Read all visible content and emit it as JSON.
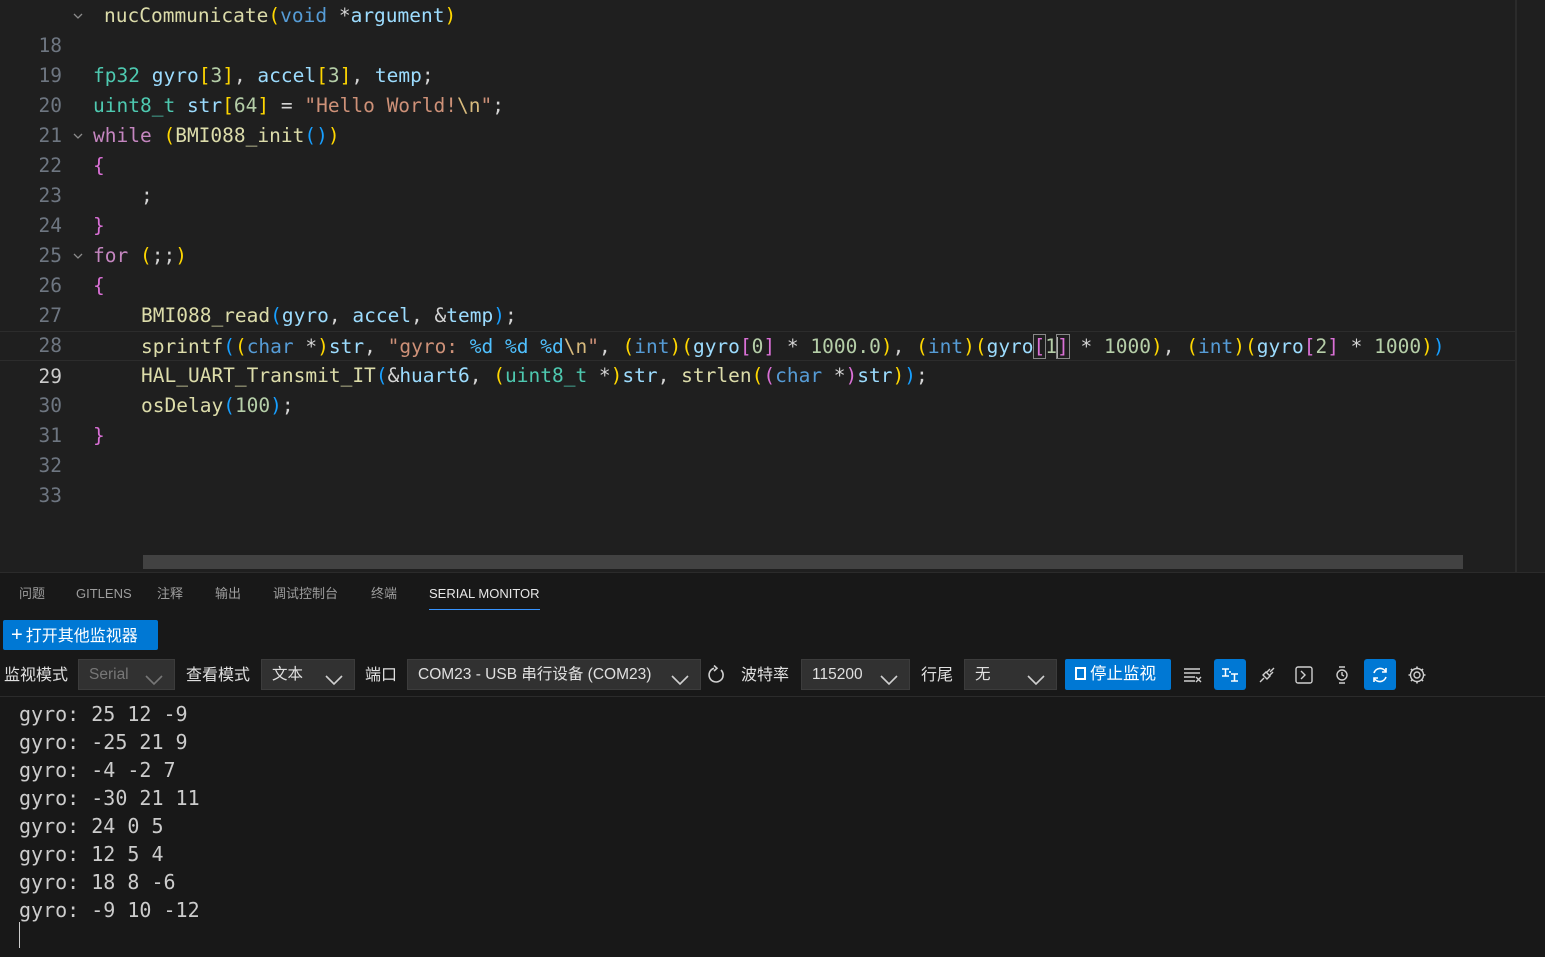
{
  "editor": {
    "lines": [
      {
        "n": "18"
      },
      {
        "n": "19"
      },
      {
        "n": "20"
      },
      {
        "n": "21"
      },
      {
        "n": "22"
      },
      {
        "n": "23"
      },
      {
        "n": "24"
      },
      {
        "n": "25"
      },
      {
        "n": "26"
      },
      {
        "n": "27"
      },
      {
        "n": "28"
      },
      {
        "n": "29"
      },
      {
        "n": "30"
      },
      {
        "n": "31"
      },
      {
        "n": "32"
      },
      {
        "n": "33"
      }
    ],
    "current_line": "29",
    "tokens": {
      "l18": [
        "nucCommunicate",
        "(",
        "void",
        " *",
        "argument",
        ")"
      ],
      "l20": [
        "fp32",
        " ",
        "gyro",
        "[",
        "3",
        "]",
        ", ",
        "accel",
        "[",
        "3",
        "]",
        ", ",
        "temp",
        ";"
      ],
      "l21": [
        "uint8_t",
        " ",
        "str",
        "[",
        "64",
        "]",
        " = ",
        "\"Hello World!",
        "\\n",
        "\"",
        ";"
      ],
      "l22": [
        "while",
        " ",
        "(",
        "BMI088_init",
        "(",
        ")",
        ")"
      ],
      "l23": [
        "{"
      ],
      "l24": [
        ";"
      ],
      "l25": [
        "}"
      ],
      "l26": [
        "for",
        " ",
        "(",
        ";;",
        ")"
      ],
      "l27": [
        "{"
      ],
      "l28": [
        "BMI088_read",
        "(",
        "gyro",
        ", ",
        "accel",
        ", &",
        "temp",
        ")",
        ";"
      ],
      "l29": [
        "sprintf",
        "(",
        "(",
        "char",
        " *",
        ")",
        "str",
        ", ",
        "\"gyro: ",
        "%d",
        " ",
        "%d",
        " ",
        "%d",
        "\\n",
        "\"",
        ", ",
        "(",
        "int",
        ")",
        "(",
        "gyro",
        "[",
        "0",
        "]",
        " * ",
        "1000.0",
        ")",
        ", ",
        "(",
        "int",
        ")",
        "(",
        "gyro",
        "[",
        "1",
        "]",
        " * ",
        "1000",
        ")",
        ", ",
        "(",
        "int",
        ")",
        "(",
        "gyro",
        "[",
        "2",
        "]",
        " * ",
        "1000",
        ")",
        ")"
      ],
      "l30": [
        "HAL_UART_Transmit_IT",
        "(",
        "&",
        "huart6",
        ", ",
        "(",
        "uint8_t",
        " *",
        ")",
        "str",
        ", ",
        "strlen",
        "(",
        "(",
        "char",
        " *",
        ")",
        "str",
        ")",
        ")",
        ";"
      ],
      "l31": [
        "osDelay",
        "(",
        "100",
        ")",
        ";"
      ],
      "l32": [
        "}"
      ]
    }
  },
  "panel": {
    "tabs": [
      {
        "label": "问题"
      },
      {
        "label": "GITLENS"
      },
      {
        "label": "注释"
      },
      {
        "label": "输出"
      },
      {
        "label": "调试控制台"
      },
      {
        "label": "终端"
      },
      {
        "label": "SERIAL MONITOR"
      }
    ],
    "active_tab": "SERIAL MONITOR",
    "open_button": {
      "icon": "plus-icon",
      "label": "打开其他监视器"
    },
    "toolbar": {
      "monitor_mode_label": "监视模式",
      "monitor_mode_value": "Serial",
      "view_mode_label": "查看模式",
      "view_mode_value": "文本",
      "port_label": "端口",
      "port_value": "COM23 - USB 串行设备 (COM23)",
      "baud_label": "波特率",
      "baud_value": "115200",
      "line_ending_label": "行尾",
      "line_ending_value": "无",
      "stop_button": "停止监视",
      "icons": [
        "clear-output-icon",
        "toggle-hex-icon",
        "plug-icon",
        "terminal-icon",
        "timestamp-icon",
        "auto-scroll-icon",
        "settings-icon"
      ]
    },
    "output_lines": [
      "gyro: 25 12 -9",
      "gyro: -25 21 9",
      "gyro: -4 -2 7",
      "gyro: -30 21 11",
      "gyro: 24 0 5",
      "gyro: 12 5 4",
      "gyro: 18 8 -6",
      "gyro: -9 10 -12"
    ]
  },
  "colors": {
    "accent": "#0078d4",
    "background": "#1f1f1f",
    "panel_background": "#181818"
  }
}
